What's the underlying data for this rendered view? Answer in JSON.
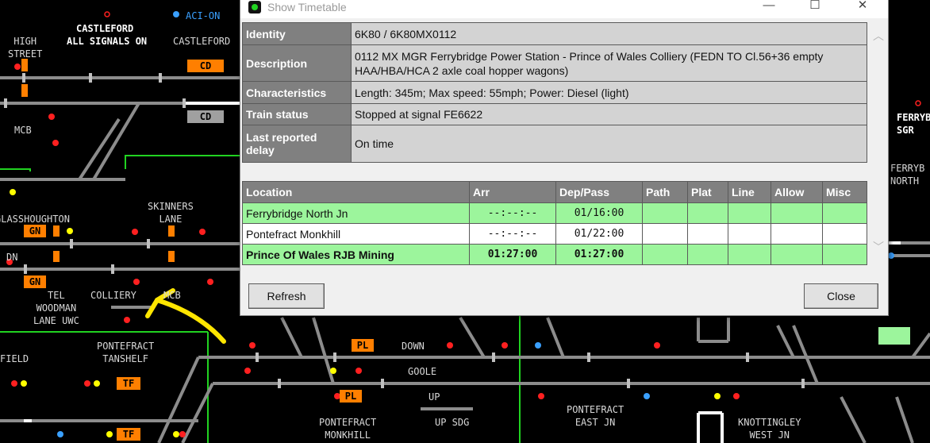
{
  "map": {
    "labels": {
      "castleford_top": "CASTLEFORD",
      "all_signals_on": "ALL SIGNALS ON",
      "aci_on": "ACI-ON",
      "high_street": "HIGH\nSTREET",
      "castleford_right": "CASTLEFORD",
      "mcb_left": "MCB",
      "glasshoughton": "GLASSHOUGHTON",
      "skinners_lane": "SKINNERS\nLANE",
      "dn_left": "DN",
      "tel_woodman": "TEL\nWOODMAN\nLANE UWC",
      "colliery": "COLLIERY",
      "mcb_mid": "MCB",
      "field": "FIELD",
      "pontefract_tanshelf": "PONTEFRACT\nTANSHELF",
      "down_arrow": "DOWN",
      "goole": "GOOLE",
      "up_arrow": "UP",
      "up_sdg": "UP SDG",
      "pontefract_monkhill": "PONTEFRACT\nMONKHILL",
      "pontefract_east_jn": "PONTEFRACT\nEAST JN",
      "knottingley_west_jn": "KNOTTINGLEY\nWEST JN",
      "ferrybridge_right": "FERRYB\nSGR",
      "ferrybridge_north": "FERRYB\nNORTH"
    },
    "tags": {
      "cd_top": "CD",
      "cd_grey": "CD",
      "gn_1": "GN",
      "gn_2": "GN",
      "pl_1": "PL",
      "pl_2": "PL",
      "tf_1": "TF",
      "tf_2": "TF"
    },
    "signal_ids": [
      "A",
      "A",
      "R",
      "A",
      "A",
      "R",
      "O",
      "O"
    ]
  },
  "dialog": {
    "title": "Show Timetable",
    "window_buttons": {
      "minimize": "—",
      "maximize": "☐",
      "close": "✕"
    },
    "info": [
      {
        "label": "Identity",
        "value": "6K80 / 6K80MX0112"
      },
      {
        "label": "Description",
        "value": "0112 MX MGR Ferrybridge Power Station - Prince of Wales Colliery (FEDN TO Cl.56+36 empty HAA/HBA/HCA 2 axle coal hopper wagons)"
      },
      {
        "label": "Characteristics",
        "value": "Length: 345m; Max speed: 55mph; Power: Diesel (light)"
      },
      {
        "label": "Train status",
        "value": "Stopped at signal FE6622"
      },
      {
        "label": "Last reported delay",
        "value": "On time"
      }
    ],
    "timetable": {
      "columns": [
        "Location",
        "Arr",
        "Dep/Pass",
        "Path",
        "Plat",
        "Line",
        "Allow",
        "Misc"
      ],
      "rows": [
        {
          "location": "Ferrybridge North Jn",
          "arr": "--:--:--",
          "dep": "01/16:00",
          "path": "",
          "plat": "",
          "line": "",
          "allow": "",
          "misc": ""
        },
        {
          "location": "Pontefract Monkhill",
          "arr": "--:--:--",
          "dep": "01/22:00",
          "path": "",
          "plat": "",
          "line": "",
          "allow": "",
          "misc": ""
        },
        {
          "location": "Prince Of Wales RJB Mining",
          "arr": "01:27:00",
          "dep": "01:27:00",
          "path": "",
          "plat": "",
          "line": "",
          "allow": "",
          "misc": ""
        }
      ]
    },
    "buttons": {
      "refresh": "Refresh",
      "close": "Close"
    }
  },
  "colors": {
    "background": "#000000",
    "track": "#8c8c8c",
    "track_white": "#ffffff",
    "route_green": "#21d321",
    "signal_red": "#ff2020",
    "signal_yellow": "#ffff00",
    "signal_blue": "#3aa0ff",
    "tag_orange": "#ff7f00",
    "row_green": "#9cf59c",
    "annotation_yellow": "#ffe600"
  }
}
